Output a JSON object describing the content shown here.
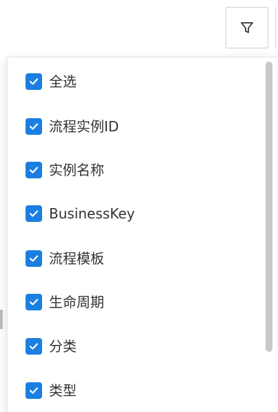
{
  "toolbar": {
    "filter_icon": "filter-icon"
  },
  "column_filter": {
    "options": [
      {
        "label": "全选",
        "checked": true
      },
      {
        "label": "流程实例ID",
        "checked": true
      },
      {
        "label": "实例名称",
        "checked": true
      },
      {
        "label": "BusinessKey",
        "checked": true
      },
      {
        "label": "流程模板",
        "checked": true
      },
      {
        "label": "生命周期",
        "checked": true
      },
      {
        "label": "分类",
        "checked": true
      },
      {
        "label": "类型",
        "checked": true
      }
    ]
  },
  "colors": {
    "checkbox": "#1a7fe0",
    "text": "#333333",
    "scrollbar": "#c9c9c9"
  }
}
